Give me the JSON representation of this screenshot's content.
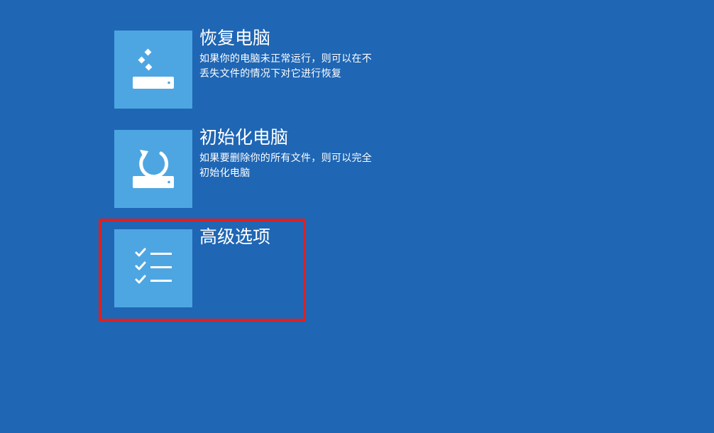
{
  "options": [
    {
      "title": "恢复电脑",
      "description": "如果你的电脑未正常运行，则可以在不丢失文件的情况下对它进行恢复",
      "icon": "restore-drive-icon"
    },
    {
      "title": "初始化电脑",
      "description": "如果要删除你的所有文件，则可以完全初始化电脑",
      "icon": "reset-drive-icon"
    },
    {
      "title": "高级选项",
      "description": "",
      "icon": "checklist-icon"
    }
  ],
  "colors": {
    "background": "#1f66b4",
    "tile": "#4da6e2",
    "text": "#ffffff",
    "highlight": "#e02020"
  }
}
